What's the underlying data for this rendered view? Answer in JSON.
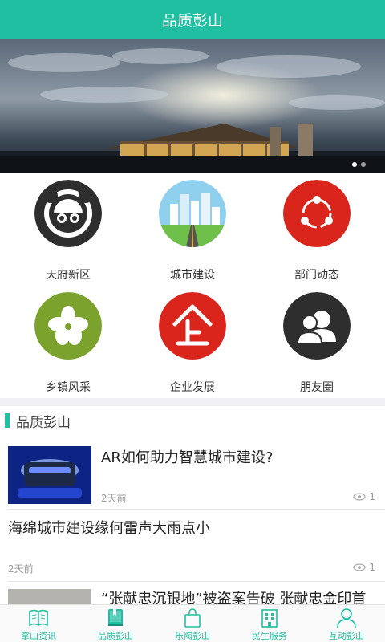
{
  "header": {
    "title": "品质彭山"
  },
  "banner": {
    "slides": 2,
    "active": 0
  },
  "grid": {
    "items": [
      {
        "label": "天府新区",
        "icon": "panda-icon"
      },
      {
        "label": "城市建设",
        "icon": "city-icon"
      },
      {
        "label": "部门动态",
        "icon": "share-icon"
      },
      {
        "label": "乡镇风采",
        "icon": "flower-icon"
      },
      {
        "label": "企业发展",
        "icon": "enterprise-icon"
      },
      {
        "label": "朋友圈",
        "icon": "friends-icon"
      }
    ]
  },
  "section": {
    "title": "品质彭山"
  },
  "news": [
    {
      "title": "AR如何助力智慧城市建设?",
      "time": "2天前",
      "views": "1"
    },
    {
      "title": "海绵城市建设缘何雷声大雨点小",
      "time": "2天前",
      "views": "1"
    },
    {
      "title": "“张献忠沉银地”被盗案告破 张献忠金印首"
    }
  ],
  "tabbar": {
    "items": [
      {
        "label": "掌山资讯",
        "icon": "book-icon"
      },
      {
        "label": "品质彭山",
        "icon": "bookmark-book-icon"
      },
      {
        "label": "乐陶彭山",
        "icon": "shopping-bag-icon"
      },
      {
        "label": "民生服务",
        "icon": "building-icon"
      },
      {
        "label": "互动彭山",
        "icon": "person-icon"
      }
    ]
  },
  "colors": {
    "accent": "#20bfa2",
    "red": "#d9251c",
    "dark": "#2e2e2e",
    "green": "#7aa22c"
  }
}
